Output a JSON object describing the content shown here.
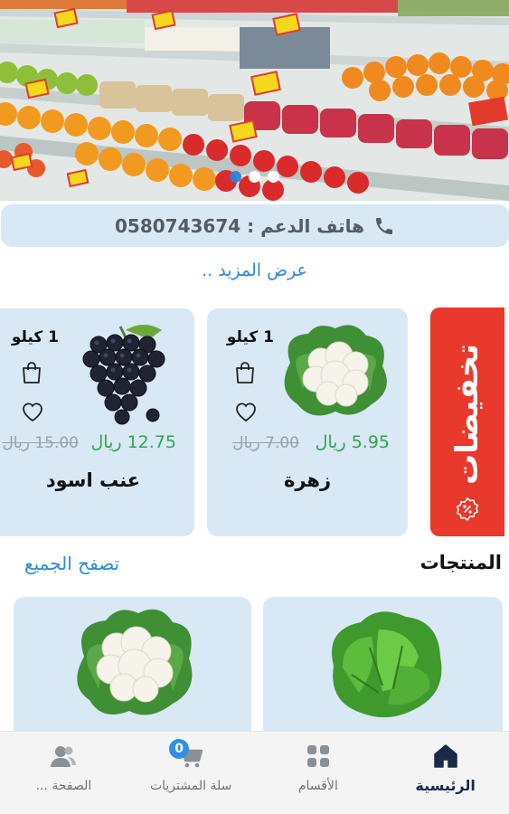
{
  "banner": {
    "slides": [
      {
        "active": true
      },
      {
        "active": false
      },
      {
        "active": false
      }
    ]
  },
  "support": {
    "label": "هاتف الدعم : 0580743674",
    "icon": "phone-icon"
  },
  "more_link": "عرض المزيد ..",
  "offers": {
    "title": "تخفيضات",
    "icon": "discount-badge-icon",
    "color": "#e8392c",
    "items": [
      {
        "name": "زهرة",
        "weight": "1 كيلو",
        "price": "5.95 ريال",
        "old_price": "7.00 ريال",
        "icon": "cauliflower-image"
      },
      {
        "name": "عنب اسود",
        "weight": "1 كيلو",
        "price": "12.75 ريال",
        "old_price": "15.00 ريال",
        "icon": "black-grapes-image"
      }
    ]
  },
  "products": {
    "title": "المنتجات",
    "browse_all": "تصفح الجميع",
    "items": [
      {
        "icon": "lettuce-image"
      },
      {
        "icon": "cauliflower-image"
      }
    ]
  },
  "bottom_nav": {
    "items": [
      {
        "label": "الرئيسية",
        "icon": "home-icon",
        "active": true
      },
      {
        "label": "الأقسام",
        "icon": "categories-icon",
        "active": false
      },
      {
        "label": "سلة المشتريات",
        "icon": "cart-icon",
        "active": false,
        "badge": "0"
      },
      {
        "label": "الصفحة ...",
        "icon": "account-icon",
        "active": false
      }
    ]
  },
  "colors": {
    "accent": "#2b8ad6",
    "card_bg": "#d8e8f5",
    "price_green": "#2ea84a",
    "sale_red": "#e8392c"
  }
}
